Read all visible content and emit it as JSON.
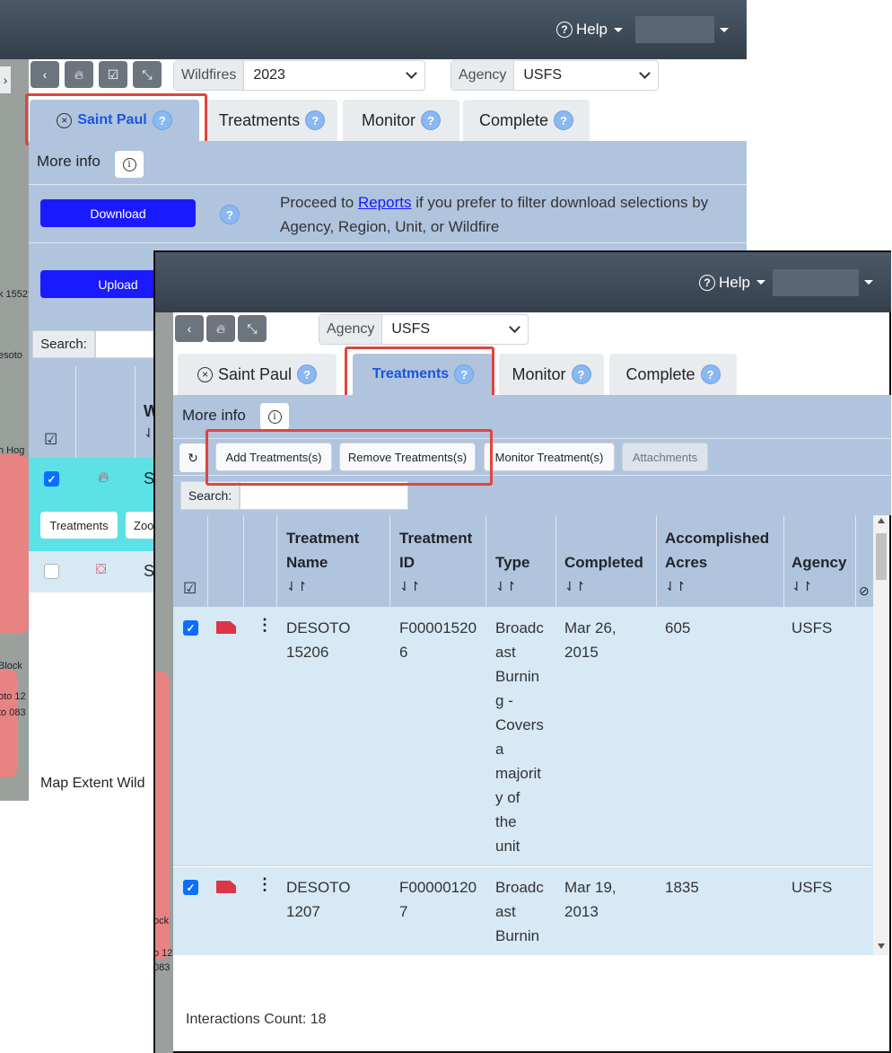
{
  "back": {
    "help_label": "Help",
    "filters": {
      "wildfires_label": "Wildfires",
      "wildfires_value": "2023",
      "agency_label": "Agency",
      "agency_value": "USFS"
    },
    "tabs": [
      {
        "label": "Saint Paul"
      },
      {
        "label": "Treatments"
      },
      {
        "label": "Monitor"
      },
      {
        "label": "Complete"
      }
    ],
    "more_info": "More info",
    "download_label": "Download",
    "upload_label": "Upload",
    "proceed_text_1": "Proceed to ",
    "reports_link": "Reports",
    "proceed_text_2": " if you prefer to filter download selections by Agency, Region, Unit, or Wildfire",
    "search_label": "Search:",
    "header_col_partial": "W",
    "row_partial_1": "Si",
    "row_partial_2": "S",
    "row_buttons": {
      "treatments": "Treatments",
      "zoom_partial": "Zoo"
    },
    "footer": "Map Extent Wild",
    "map_labels": [
      "k 1552",
      "esoto",
      "h Hog",
      "1552",
      "oto",
      "Block",
      "oto 12",
      "to 083"
    ]
  },
  "front": {
    "help_label": "Help",
    "filters": {
      "agency_label": "Agency",
      "agency_value": "USFS"
    },
    "tabs": [
      {
        "label": "Saint Paul"
      },
      {
        "label": "Treatments"
      },
      {
        "label": "Monitor"
      },
      {
        "label": "Complete"
      }
    ],
    "more_info": "More info",
    "actions": {
      "add": "Add Treatments(s)",
      "remove": "Remove Treatments(s)",
      "monitor": "Monitor Treatment(s)",
      "attachments": "Attachments"
    },
    "search_label": "Search:",
    "columns": {
      "name": [
        "Treatment",
        "Name"
      ],
      "id": [
        "Treatment",
        "ID"
      ],
      "type": [
        "Type"
      ],
      "completed": [
        "Completed"
      ],
      "acres": [
        "Accomplished",
        "Acres"
      ],
      "agency": [
        "Agency"
      ]
    },
    "sort_glyph": "⇃↾",
    "rows": [
      {
        "name": [
          "DESOTO",
          "15206"
        ],
        "id": [
          "F00001520",
          "6"
        ],
        "type": [
          "Broadc",
          "ast",
          "Burnin",
          "g -",
          "Covers",
          "a",
          "majorit",
          "y of",
          "the",
          "unit"
        ],
        "completed": [
          "Mar 26,",
          "2015"
        ],
        "acres": "605",
        "agency": "USFS"
      },
      {
        "name": [
          "DESOTO",
          "1207"
        ],
        "id": [
          "F00000120",
          "7"
        ],
        "type": [
          "Broadc",
          "ast",
          "Burnin"
        ],
        "completed": [
          "Mar 19,",
          "2013"
        ],
        "acres": "1835",
        "agency": "USFS"
      }
    ],
    "interactions": "Interactions Count: 18",
    "map_labels": [
      "ock",
      "o 12",
      "083"
    ]
  },
  "colors": {
    "navbar": "#343f4b",
    "tab_active": "#b0c4de",
    "panel": "#b0c4de",
    "row_bg": "#d6e9f5",
    "primary": "#1a1aff",
    "highlight": "#e0443e",
    "flag": "#dc3545"
  }
}
